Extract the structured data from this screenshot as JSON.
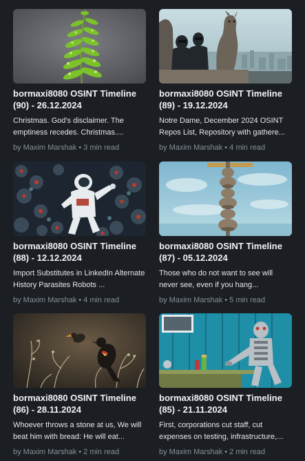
{
  "posts": [
    {
      "title": "bormaxi8080 OSINT Timeline (90) - 26.12.2024",
      "excerpt": "Christmas. God's disclaimer. The emptiness recedes. Christmas....",
      "author": "by Maxim Marshak",
      "read_time": "3 min read",
      "image": "fern-leaf-with-water-droplets"
    },
    {
      "title": "bormaxi8080 OSINT Timeline (89) - 19.12.2024",
      "excerpt": "Notre Dame, December 2024 OSINT Repos List, Repository with gathere...",
      "author": "by Maxim Marshak",
      "read_time": "4 min read",
      "image": "figures-beside-gargoyle-over-paris"
    },
    {
      "title": "bormaxi8080 OSINT Timeline (88) - 12.12.2024",
      "excerpt": "Import Substitutes in LinkedIn Alternate History Parasites Robots ...",
      "author": "by Maxim Marshak",
      "read_time": "4 min read",
      "image": "astronaut-among-creatures"
    },
    {
      "title": "bormaxi8080 OSINT Timeline (87) - 05.12.2024",
      "excerpt": "Those who do not want to see will never see, even if you hang...",
      "author": "by Maxim Marshak",
      "read_time": "5 min read",
      "image": "stacked-stones-pole-under-sky"
    },
    {
      "title": "bormaxi8080 OSINT Timeline (86) - 28.11.2024",
      "excerpt": "Whoever throws a stone at us, We will beat him with bread: He will eat...",
      "author": "by Maxim Marshak",
      "read_time": "2 min read",
      "image": "birds-on-branches"
    },
    {
      "title": "bormaxi8080 OSINT Timeline (85) - 21.11.2024",
      "excerpt": "First, corporations cut staff, cut expenses on testing, infrastructure,...",
      "author": "by Maxim Marshak",
      "read_time": "2 min read",
      "image": "robot-sitting-at-table"
    }
  ],
  "meta_separator": "•",
  "colors": {
    "background": "#1b1e22",
    "title": "#f1f3f5",
    "excerpt": "#e6e8eb",
    "meta": "#8a9099"
  }
}
